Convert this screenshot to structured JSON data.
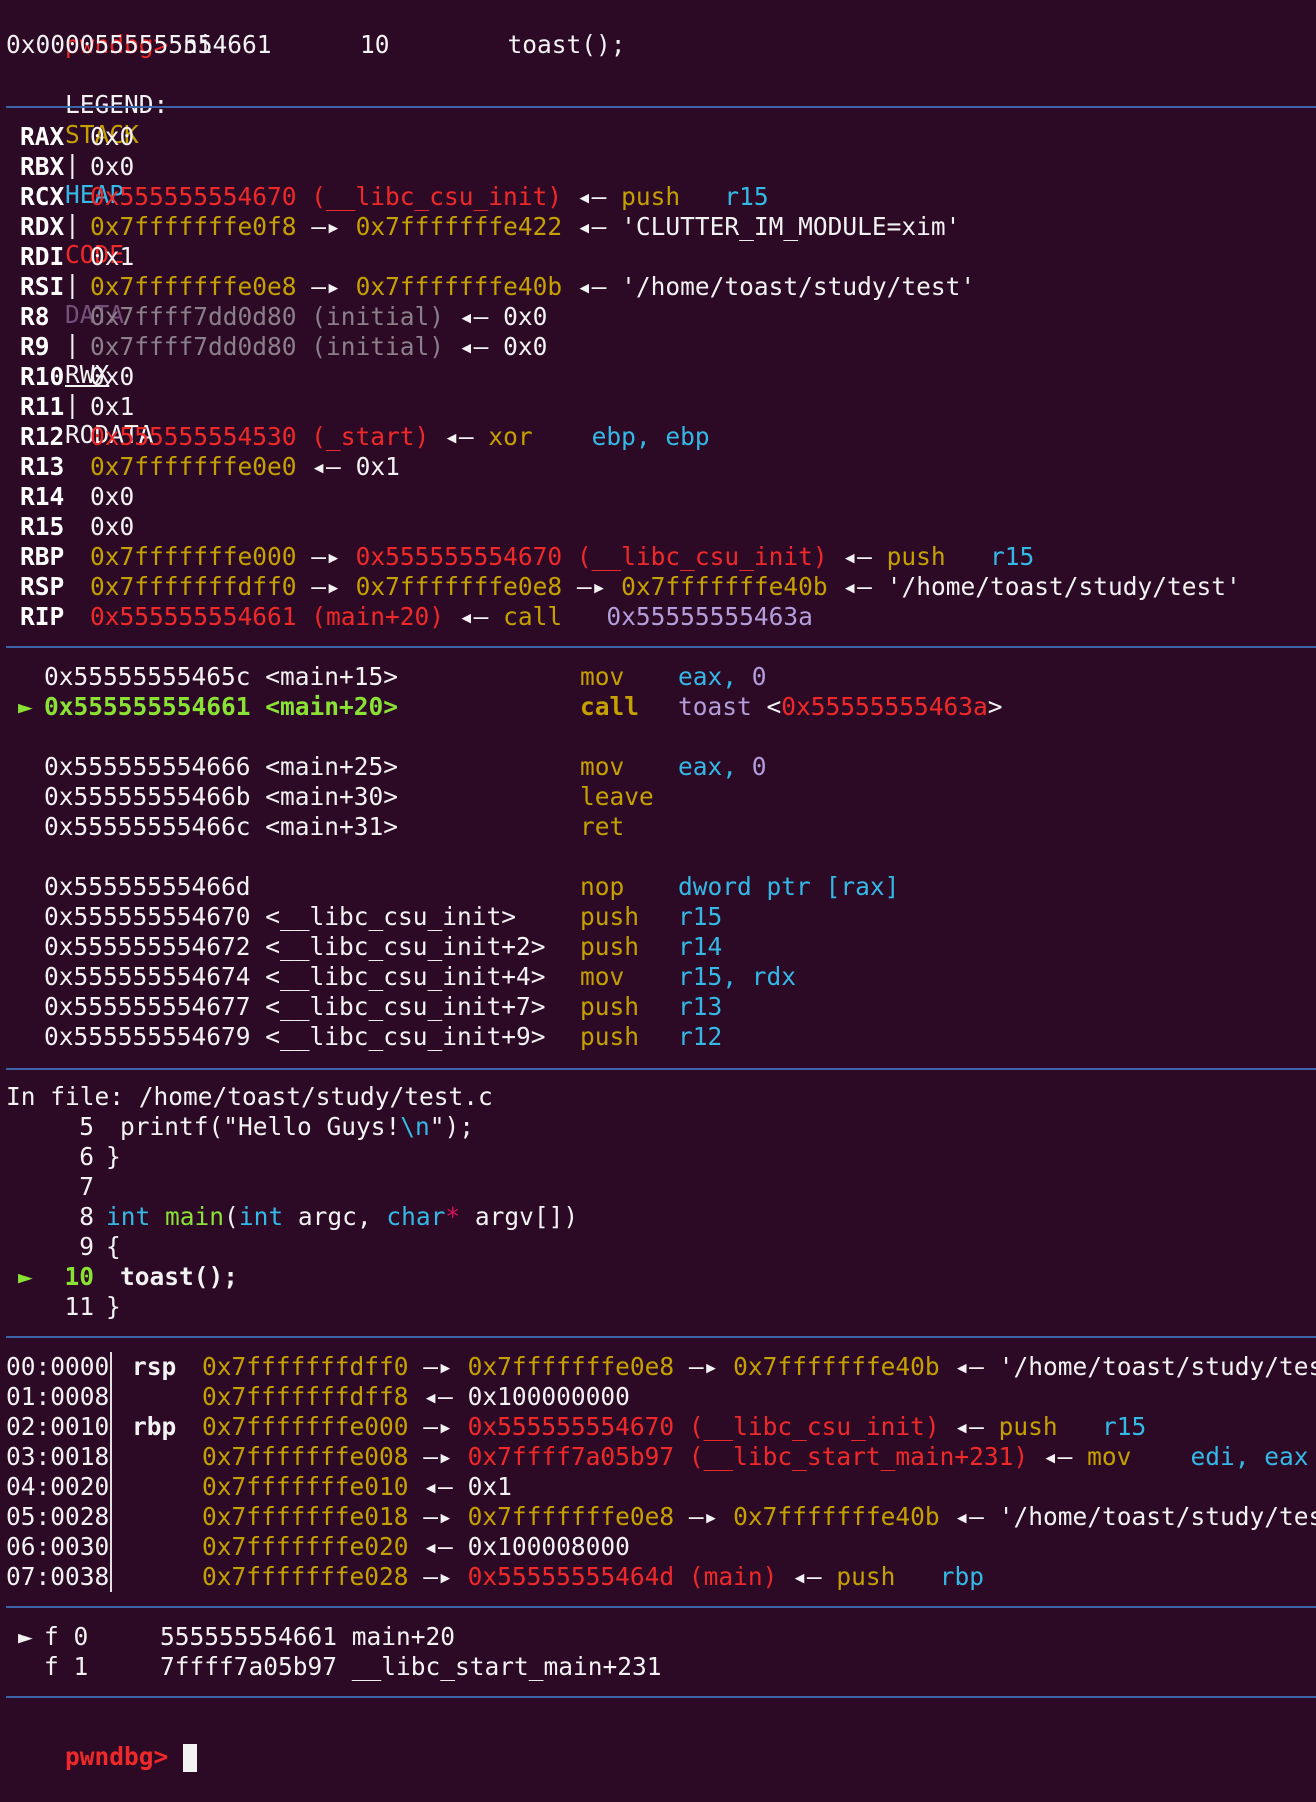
{
  "prompt": {
    "label": "pwndbg>",
    "command": "ni"
  },
  "status_line": "0x0000555555554661      10        toast();",
  "legend": {
    "label": "LEGEND:",
    "items": [
      "STACK",
      "HEAP",
      "CODE",
      "DATA",
      "RWX",
      "RODATA"
    ],
    "separator": "|"
  },
  "registers": [
    {
      "name": "RAX",
      "value": "0x0"
    },
    {
      "name": "RBX",
      "value": "0x0"
    },
    {
      "name": "RCX",
      "value": "0x555555554670 (__libc_csu_init) ◂— push   r15"
    },
    {
      "name": "RDX",
      "value": "0x7fffffffe0f8 —▸ 0x7fffffffe422 ◂— 'CLUTTER_IM_MODULE=xim'"
    },
    {
      "name": "RDI",
      "value": "0x1"
    },
    {
      "name": "RSI",
      "value": "0x7fffffffe0e8 —▸ 0x7fffffffe40b ◂— '/home/toast/study/test'"
    },
    {
      "name": "R8",
      "value": "0x7ffff7dd0d80 (initial) ◂— 0x0"
    },
    {
      "name": "R9",
      "value": "0x7ffff7dd0d80 (initial) ◂— 0x0"
    },
    {
      "name": "R10",
      "value": "0x0"
    },
    {
      "name": "R11",
      "value": "0x1"
    },
    {
      "name": "R12",
      "value": "0x555555554530 (_start) ◂— xor    ebp, ebp"
    },
    {
      "name": "R13",
      "value": "0x7fffffffe0e0 ◂— 0x1"
    },
    {
      "name": "R14",
      "value": "0x0"
    },
    {
      "name": "R15",
      "value": "0x0"
    },
    {
      "name": "RBP",
      "value": "0x7fffffffe000 —▸ 0x555555554670 (__libc_csu_init) ◂— push   r15"
    },
    {
      "name": "RSP",
      "value": "0x7fffffffdff0 —▸ 0x7fffffffe0e8 —▸ 0x7fffffffe40b ◂— '/home/toast/study/test'"
    },
    {
      "name": "RIP",
      "value": "0x555555554661 (main+20) ◂— call   0x55555555463a"
    }
  ],
  "disasm": [
    {
      "marker": "",
      "addr": "0x55555555465c <main+15>",
      "op": "mov",
      "args": "eax, 0"
    },
    {
      "marker": "►",
      "addr": "0x555555554661 <main+20>",
      "op": "call",
      "args": "toast <0x55555555463a>"
    },
    {
      "marker": "",
      "addr": "0x555555554666 <main+25>",
      "op": "mov",
      "args": "eax, 0"
    },
    {
      "marker": "",
      "addr": "0x55555555466b <main+30>",
      "op": "leave",
      "args": ""
    },
    {
      "marker": "",
      "addr": "0x55555555466c <main+31>",
      "op": "ret",
      "args": ""
    },
    {
      "marker": "",
      "addr": "0x55555555466d",
      "op": "nop",
      "args": "dword ptr [rax]"
    },
    {
      "marker": "",
      "addr": "0x555555554670 <__libc_csu_init>",
      "op": "push",
      "args": "r15"
    },
    {
      "marker": "",
      "addr": "0x555555554672 <__libc_csu_init+2>",
      "op": "push",
      "args": "r14"
    },
    {
      "marker": "",
      "addr": "0x555555554674 <__libc_csu_init+4>",
      "op": "mov",
      "args": "r15, rdx"
    },
    {
      "marker": "",
      "addr": "0x555555554677 <__libc_csu_init+7>",
      "op": "push",
      "args": "r13"
    },
    {
      "marker": "",
      "addr": "0x555555554679 <__libc_csu_init+9>",
      "op": "push",
      "args": "r12"
    }
  ],
  "source": {
    "file_line": "In file: /home/toast/study/test.c",
    "lines": [
      {
        "marker": "",
        "num": "5",
        "code": "printf(\"Hello Guys!\\n\");"
      },
      {
        "marker": "",
        "num": "6",
        "code": "}"
      },
      {
        "marker": "",
        "num": "7",
        "code": ""
      },
      {
        "marker": "",
        "num": "8",
        "code": "int main(int argc, char* argv[])"
      },
      {
        "marker": "",
        "num": "9",
        "code": "{"
      },
      {
        "marker": "►",
        "num": "10",
        "code": "toast();"
      },
      {
        "marker": "",
        "num": "11",
        "code": "}"
      }
    ]
  },
  "stack": [
    {
      "offset": "00:0000",
      "reg": "rsp",
      "value": "0x7fffffffdff0 —▸ 0x7fffffffe0e8 —▸ 0x7fffffffe40b ◂— '/home/toast/study/test'"
    },
    {
      "offset": "01:0008",
      "reg": "",
      "value": "0x7fffffffdff8 ◂— 0x100000000"
    },
    {
      "offset": "02:0010",
      "reg": "rbp",
      "value": "0x7fffffffe000 —▸ 0x555555554670 (__libc_csu_init) ◂— push   r15"
    },
    {
      "offset": "03:0018",
      "reg": "",
      "value": "0x7fffffffe008 —▸ 0x7ffff7a05b97 (__libc_start_main+231) ◂— mov    edi, eax"
    },
    {
      "offset": "04:0020",
      "reg": "",
      "value": "0x7fffffffe010 ◂— 0x1"
    },
    {
      "offset": "05:0028",
      "reg": "",
      "value": "0x7fffffffe018 —▸ 0x7fffffffe0e8 —▸ 0x7fffffffe40b ◂— '/home/toast/study/test'"
    },
    {
      "offset": "06:0030",
      "reg": "",
      "value": "0x7fffffffe020 ◂— 0x100008000"
    },
    {
      "offset": "07:0038",
      "reg": "",
      "value": "0x7fffffffe028 —▸ 0x55555555464d (main) ◂— push   rbp"
    }
  ],
  "backtrace": [
    {
      "marker": "►",
      "frame": "f 0",
      "addr": "555555554661",
      "sym": "main+20"
    },
    {
      "marker": "",
      "frame": "f 1",
      "addr": "7ffff7a05b97",
      "sym": "__libc_start_main+231"
    }
  ],
  "final_prompt": "pwndbg>"
}
